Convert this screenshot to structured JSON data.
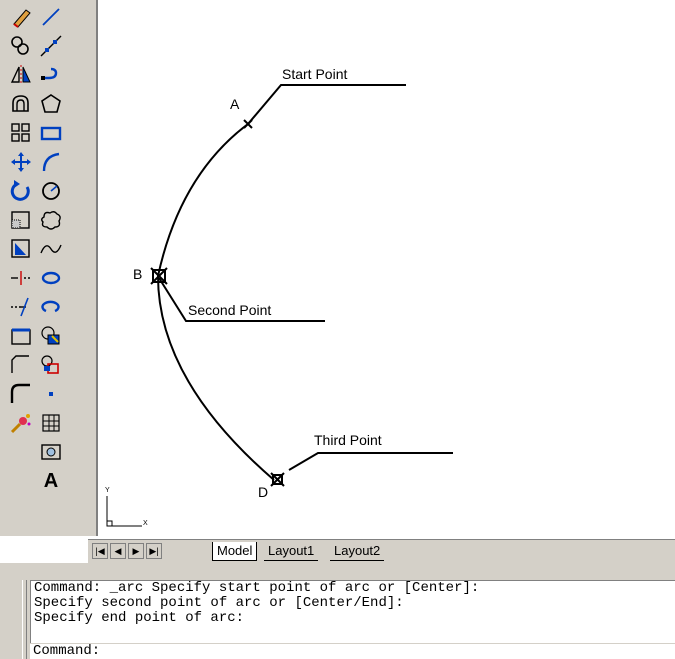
{
  "toolbar_left": {
    "icons": [
      "eraser-icon",
      "copy-icon",
      "mirror-icon",
      "offset-icon",
      "array-icon",
      "move-icon",
      "rotate-icon",
      "scale-icon",
      "stretch-icon",
      "trim-icon",
      "extend-icon",
      "break-icon",
      "chamfer-icon",
      "fillet-icon",
      "explode-icon"
    ]
  },
  "toolbar_right": {
    "icons": [
      "line-icon",
      "construction-line-icon",
      "polyline-icon",
      "polygon-icon",
      "rectangle-icon",
      "arc-icon",
      "circle-icon",
      "revision-cloud-icon",
      "spline-icon",
      "ellipse-icon",
      "ellipse-arc-icon",
      "insert-block-icon",
      "make-block-icon",
      "point-icon",
      "hatch-icon",
      "region-icon"
    ],
    "text_tool": "A"
  },
  "drawing": {
    "point_a": "A",
    "point_b": "B",
    "point_d": "D",
    "start_label": "Start Point",
    "second_label": "Second Point",
    "third_label": "Third Point",
    "ucs_y": "Y",
    "ucs_x": "X"
  },
  "tabs": {
    "model": "Model",
    "layout1": "Layout1",
    "layout2": "Layout2"
  },
  "command": {
    "history": [
      "Command: _arc Specify start point of arc or [Center]:",
      "Specify second point of arc or [Center/End]:",
      "Specify end point of arc:"
    ],
    "prompt": "Command:"
  }
}
